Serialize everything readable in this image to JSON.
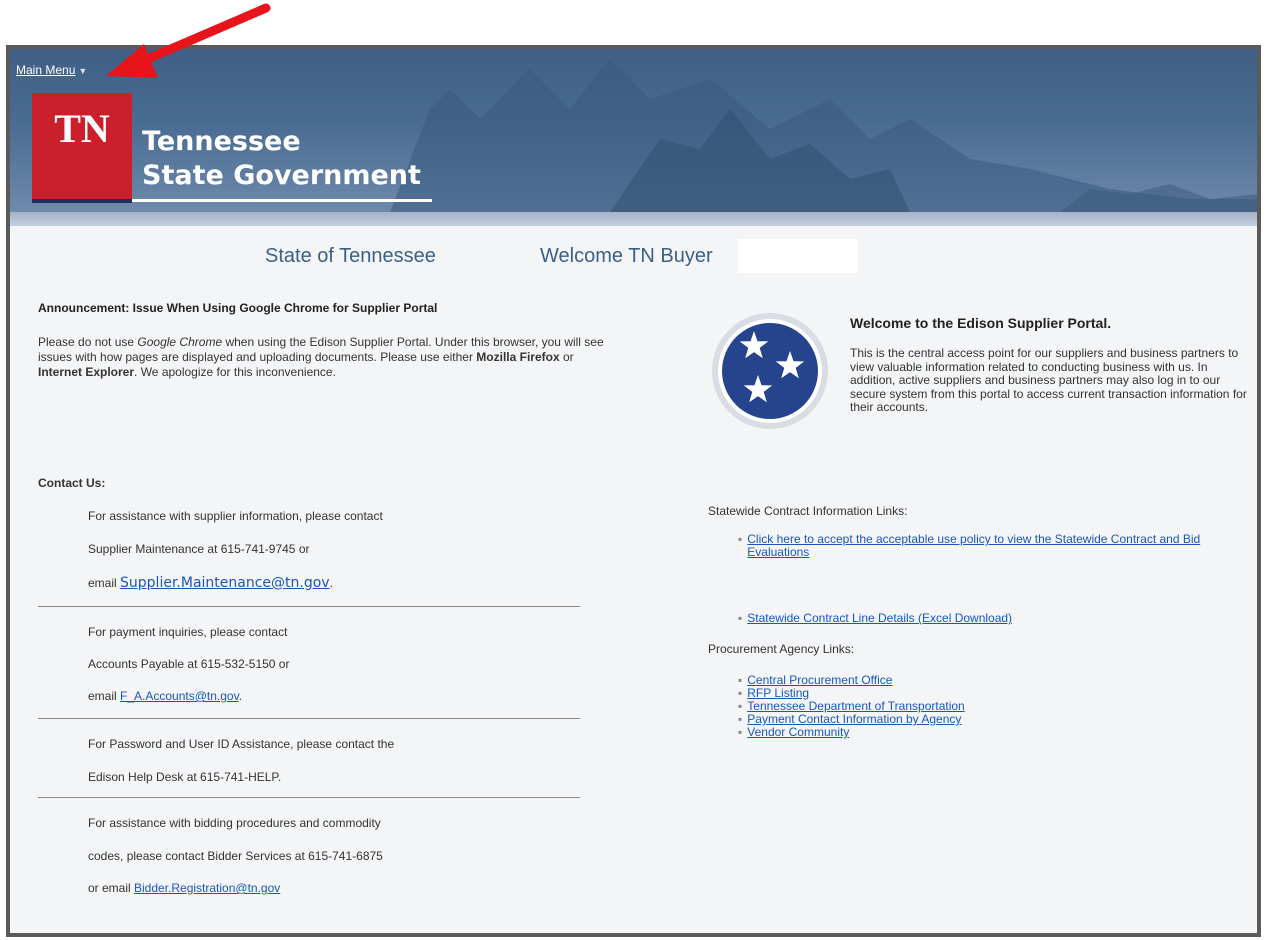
{
  "nav": {
    "main_menu": "Main Menu"
  },
  "brand": {
    "logo_text": "TN",
    "line1": "Tennessee",
    "line2": "State Government"
  },
  "header": {
    "state_title": "State of Tennessee",
    "welcome_title": "Welcome  TN Buyer"
  },
  "announcement": {
    "title": "Announcement: Issue When Using Google Chrome for Supplier Portal",
    "p1": "Please do not use ",
    "chrome": "Google Chrome",
    "p2": " when using the Edison Supplier Portal. Under this browser, you will see issues with how pages are displayed and uploading documents. Please use either ",
    "firefox": "Mozilla Firefox",
    "or": " or ",
    "ie": "Internet Explorer",
    "p3": ".  We apologize for this inconvenience."
  },
  "contact": {
    "title": "Contact Us:",
    "supplier_1": "For assistance with supplier information, please contact",
    "supplier_2": "Supplier Maintenance at 615-741-9745 or",
    "supplier_3_prefix": "email ",
    "supplier_email": "Supplier.Maintenance@tn.gov",
    "supplier_3_suffix": ".",
    "payment_1": "For payment inquiries, please contact",
    "payment_2": "Accounts Payable at 615-532-5150 or",
    "payment_3_prefix": "email ",
    "payment_email": "F_A.Accounts@tn.gov",
    "payment_3_suffix": ".",
    "password_1": "For Password and User ID Assistance, please contact the",
    "password_2": "Edison Help Desk at  615-741-HELP.",
    "bidding_1": "For assistance with bidding procedures and commodity",
    "bidding_2": "codes, please contact Bidder Services at 615-741-6875",
    "bidding_3_prefix": "or email ",
    "bidding_email": "Bidder.Registration@tn.gov"
  },
  "portal": {
    "title": "Welcome to the Edison Supplier Portal.",
    "body": "This is the central access point for our suppliers and business partners to view valuable information related to conducting business with us. In addition, active suppliers and business partners may also log in to our secure system from this portal to access current transaction information for their accounts."
  },
  "statewide": {
    "label": "Statewide Contract Information Links:",
    "link_policy": "Click here to accept the acceptable use policy to view the Statewide Contract and Bid Evaluations",
    "link_excel": "Statewide Contract Line Details  (Excel Download)"
  },
  "procurement": {
    "label": "Procurement Agency Links:",
    "links": [
      "Central Procurement Office",
      "RFP Listing",
      "Tennessee Department of Transportation",
      "Payment Contact Information by Agency",
      "Vendor Community"
    ]
  },
  "colors": {
    "banner": "#45668e",
    "tn_red": "#cc1f2c",
    "link": "#1a56b8",
    "heading": "#3b5f86",
    "arrow": "#e8141c"
  }
}
